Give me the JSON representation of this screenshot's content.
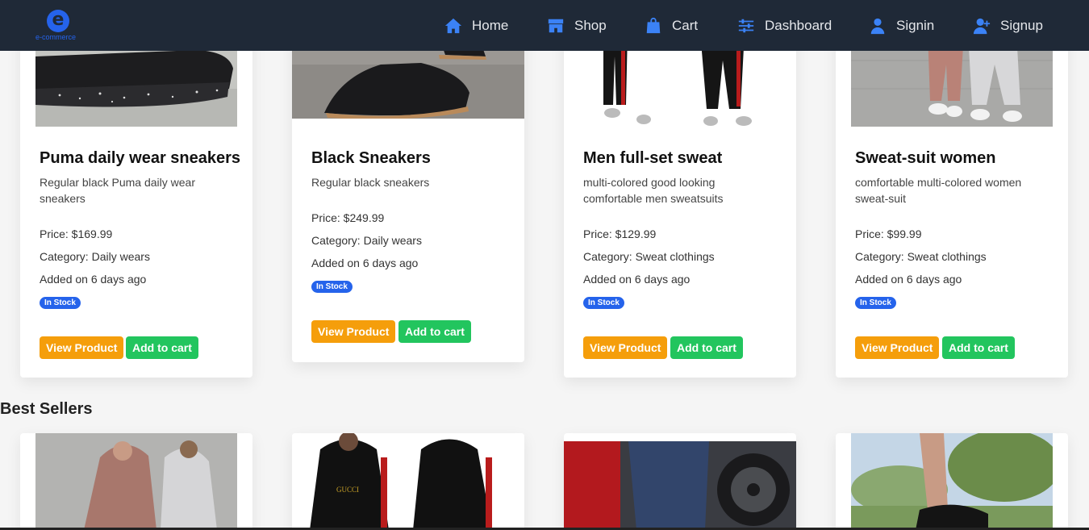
{
  "brand": {
    "logo_letter": "e",
    "logo_text": "e-commerce"
  },
  "nav": [
    {
      "label": "Home",
      "icon": "home-icon"
    },
    {
      "label": "Shop",
      "icon": "shop-icon"
    },
    {
      "label": "Cart",
      "icon": "bag-icon"
    },
    {
      "label": "Dashboard",
      "icon": "sliders-icon"
    },
    {
      "label": "Signin",
      "icon": "user-icon"
    },
    {
      "label": "Signup",
      "icon": "user-plus-icon"
    }
  ],
  "products": [
    {
      "title": "Puma daily wear sneakers",
      "description": "Regular black Puma daily wear sneakers",
      "price": "Price: $169.99",
      "category": "Category: Daily wears",
      "added": "Added on 6 days ago",
      "stock": "In Stock",
      "view_label": "View Product",
      "cart_label": "Add to cart"
    },
    {
      "title": "Black Sneakers",
      "description": "Regular black sneakers",
      "price": "Price: $249.99",
      "category": "Category: Daily wears",
      "added": "Added on 6 days ago",
      "stock": "In Stock",
      "view_label": "View Product",
      "cart_label": "Add to cart"
    },
    {
      "title": "Men full-set sweat",
      "description": "multi-colored good looking comfortable men sweatsuits",
      "price": "Price: $129.99",
      "category": "Category: Sweat clothings",
      "added": "Added on 6 days ago",
      "stock": "In Stock",
      "view_label": "View Product",
      "cart_label": "Add to cart"
    },
    {
      "title": "Sweat-suit women",
      "description": "comfortable multi-colored women sweat-suit",
      "price": "Price: $99.99",
      "category": "Category: Sweat clothings",
      "added": "Added on 6 days ago",
      "stock": "In Stock",
      "view_label": "View Product",
      "cart_label": "Add to cart"
    }
  ],
  "best_sellers": {
    "title": "Best Sellers"
  },
  "image_text": {
    "gucci_logo": "GUCCI"
  },
  "colors": {
    "navbar": "#1f2937",
    "accent": "#3b82f6",
    "view_button": "#f59e0b",
    "cart_button": "#22c55e",
    "badge": "#2563eb"
  }
}
